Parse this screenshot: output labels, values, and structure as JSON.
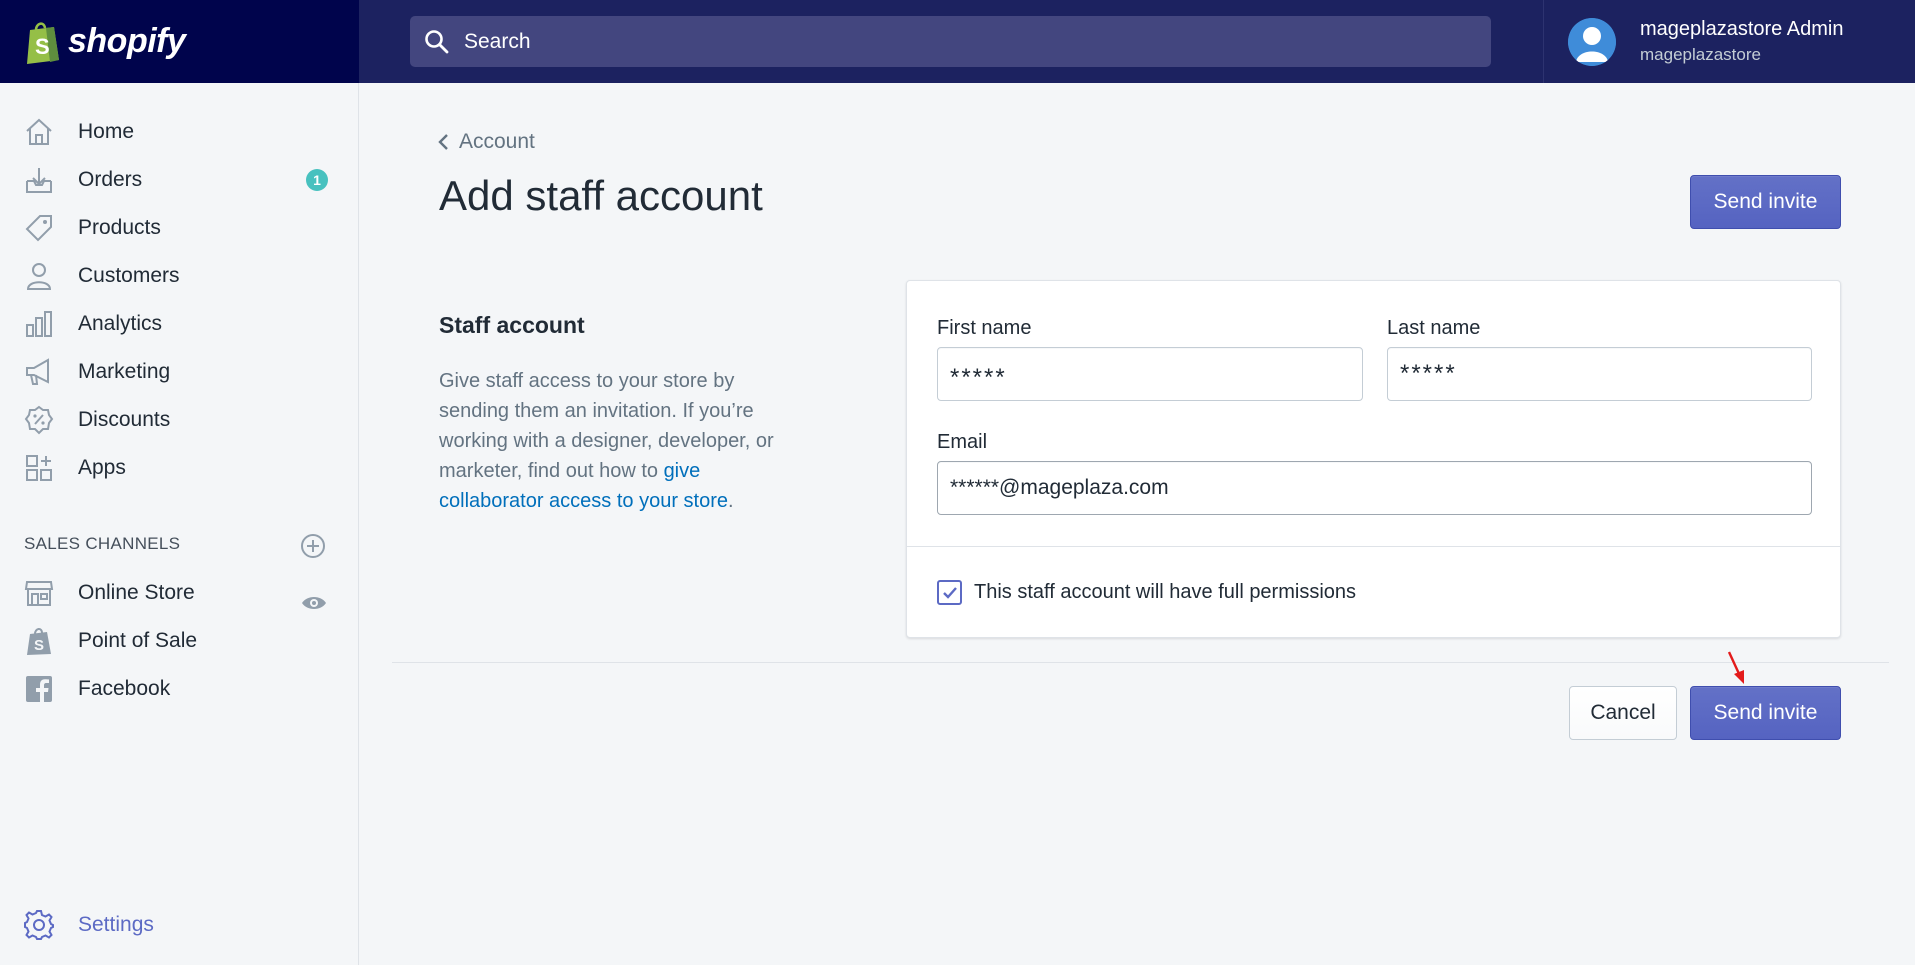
{
  "brand": {
    "name": "shopify"
  },
  "search": {
    "placeholder": "Search"
  },
  "user": {
    "name": "mageplazastore Admin",
    "store": "mageplazastore"
  },
  "sidebar": {
    "items": [
      {
        "label": "Home",
        "icon": "home-icon"
      },
      {
        "label": "Orders",
        "icon": "orders-icon",
        "badge": "1"
      },
      {
        "label": "Products",
        "icon": "tag-icon"
      },
      {
        "label": "Customers",
        "icon": "person-icon"
      },
      {
        "label": "Analytics",
        "icon": "bar-chart-icon"
      },
      {
        "label": "Marketing",
        "icon": "megaphone-icon"
      },
      {
        "label": "Discounts",
        "icon": "discount-icon"
      },
      {
        "label": "Apps",
        "icon": "apps-icon"
      }
    ],
    "sales_channels_header": "SALES CHANNELS",
    "channels": [
      {
        "label": "Online Store",
        "icon": "store-icon"
      },
      {
        "label": "Point of Sale",
        "icon": "pos-bag-icon"
      },
      {
        "label": "Facebook",
        "icon": "facebook-icon"
      }
    ],
    "settings_label": "Settings"
  },
  "page": {
    "breadcrumb": "Account",
    "title": "Add staff account",
    "send_invite_label": "Send invite",
    "cancel_label": "Cancel"
  },
  "section": {
    "heading": "Staff account",
    "description_before": "Give staff access to your store by sending them an invitation. If you’re working with a designer, developer, or marketer, find out how to ",
    "description_link": "give collaborator access to your store",
    "description_after": "."
  },
  "form": {
    "first_name_label": "First name",
    "first_name_value": "*****",
    "last_name_label": "Last name",
    "last_name_value": "*****",
    "email_label": "Email",
    "email_value": "******@mageplaza.com",
    "permissions_label": "This staff account will have full permissions",
    "permissions_checked": true
  },
  "colors": {
    "topbar": "#1c2260",
    "brand_bg": "#00044c",
    "primary": "#5c6ac4",
    "badge": "#47c1bf",
    "link": "#006fbb",
    "arrow": "#e31b1b"
  }
}
